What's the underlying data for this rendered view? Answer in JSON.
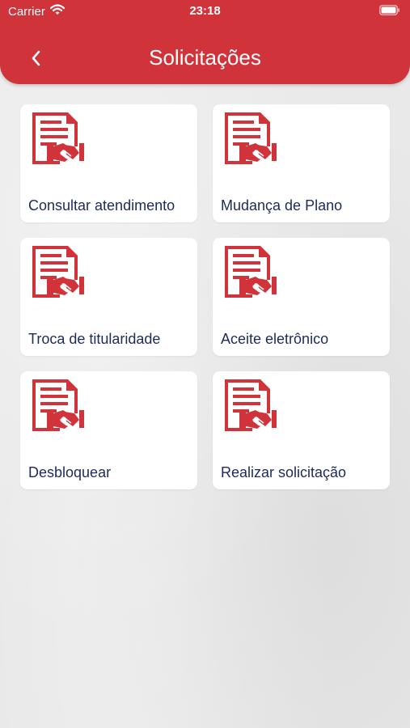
{
  "status_bar": {
    "carrier": "Carrier",
    "time": "23:18",
    "icons": [
      "wifi-icon",
      "battery-icon"
    ]
  },
  "header": {
    "title": "Solicitações",
    "back_icon": "chevron-left-icon",
    "color": "#d1333b"
  },
  "cards": [
    {
      "label": "Consultar atendimento",
      "icon": "document-handshake-icon"
    },
    {
      "label": "Mudança de Plano",
      "icon": "document-handshake-icon"
    },
    {
      "label": "Troca de titularidade",
      "icon": "document-handshake-icon"
    },
    {
      "label": "Aceite eletrônico",
      "icon": "document-handshake-icon"
    },
    {
      "label": "Desbloquear",
      "icon": "document-handshake-icon"
    },
    {
      "label": "Realizar solicitação",
      "icon": "document-handshake-icon"
    }
  ],
  "colors": {
    "accent": "#d1333b",
    "label_text": "#1d2a5a",
    "card_bg": "#ffffff",
    "page_bg": "#e9e9e9"
  }
}
